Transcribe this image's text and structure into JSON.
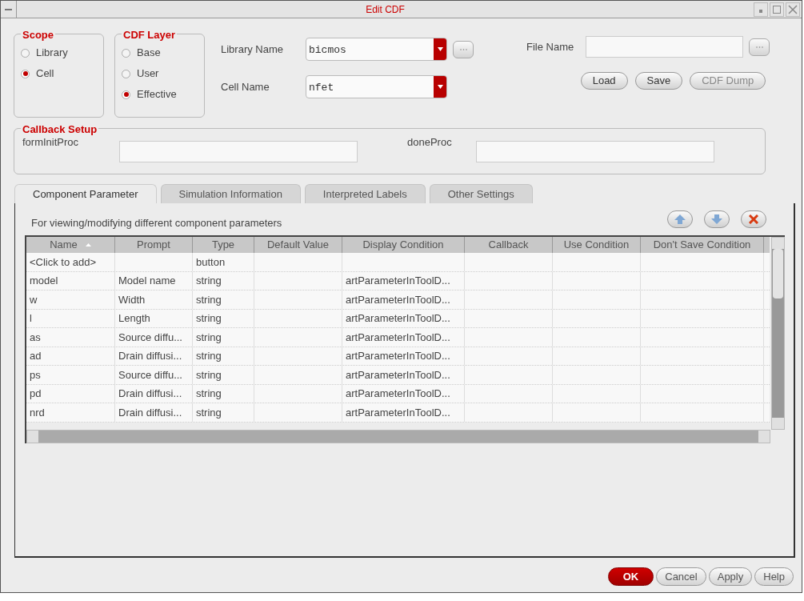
{
  "window": {
    "title": "Edit CDF"
  },
  "scope": {
    "label": "Scope",
    "options": [
      {
        "label": "Library",
        "selected": false
      },
      {
        "label": "Cell",
        "selected": true
      }
    ]
  },
  "cdf_layer": {
    "label": "CDF Layer",
    "options": [
      {
        "label": "Base",
        "selected": false
      },
      {
        "label": "User",
        "selected": false
      },
      {
        "label": "Effective",
        "selected": true
      }
    ]
  },
  "library_name": {
    "label": "Library Name",
    "value": "bicmos"
  },
  "cell_name": {
    "label": "Cell Name",
    "value": "nfet"
  },
  "file_name": {
    "label": "File Name"
  },
  "file_buttons": [
    {
      "label": "Load",
      "disabled": false
    },
    {
      "label": "Save",
      "disabled": false
    },
    {
      "label": "CDF Dump",
      "disabled": true
    }
  ],
  "callback_setup": {
    "label": "Callback Setup",
    "fields": [
      {
        "label": "formInitProc"
      },
      {
        "label": "doneProc"
      }
    ]
  },
  "tabs": [
    {
      "label": "Component Parameter",
      "selected": true
    },
    {
      "label": "Simulation Information",
      "selected": false
    },
    {
      "label": "Interpreted Labels",
      "selected": false
    },
    {
      "label": "Other Settings",
      "selected": false
    }
  ],
  "description": "For viewing/modifying different component parameters",
  "table": {
    "columns": [
      "Name",
      "Prompt",
      "Type",
      "Default Value",
      "Display Condition",
      "Callback",
      "Use Condition",
      "Don't Save Condition"
    ],
    "rows": [
      [
        "<Click to add>",
        "",
        "button",
        "",
        "",
        "",
        "",
        ""
      ],
      [
        "model",
        "Model name",
        "string",
        "",
        "artParameterInToolD...",
        "",
        "",
        ""
      ],
      [
        "w",
        "Width",
        "string",
        "",
        "artParameterInToolD...",
        "",
        "",
        ""
      ],
      [
        "l",
        "Length",
        "string",
        "",
        "artParameterInToolD...",
        "",
        "",
        ""
      ],
      [
        "as",
        "Source diffu...",
        "string",
        "",
        "artParameterInToolD...",
        "",
        "",
        ""
      ],
      [
        "ad",
        "Drain diffusi...",
        "string",
        "",
        "artParameterInToolD...",
        "",
        "",
        ""
      ],
      [
        "ps",
        "Source diffu...",
        "string",
        "",
        "artParameterInToolD...",
        "",
        "",
        ""
      ],
      [
        "pd",
        "Drain diffusi...",
        "string",
        "",
        "artParameterInToolD...",
        "",
        "",
        ""
      ],
      [
        "nrd",
        "Drain diffusi...",
        "string",
        "",
        "artParameterInToolD...",
        "",
        "",
        ""
      ]
    ]
  },
  "footer_buttons": [
    {
      "label": "OK",
      "kind": "primary"
    },
    {
      "label": "Cancel",
      "kind": "normal"
    },
    {
      "label": "Apply",
      "kind": "normal"
    },
    {
      "label": "Help",
      "kind": "normal"
    }
  ]
}
